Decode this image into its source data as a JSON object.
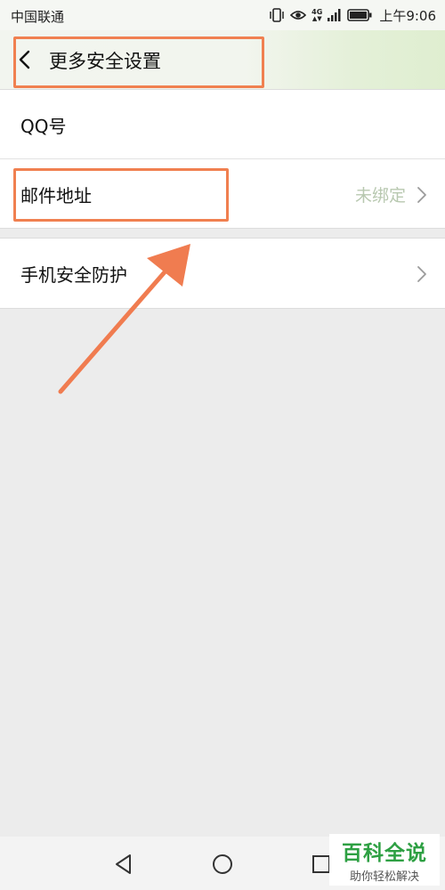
{
  "status_bar": {
    "carrier": "中国联通",
    "network_tag": "4G",
    "time": "上午9:06"
  },
  "header": {
    "title": "更多安全设置"
  },
  "settings": {
    "rows": [
      {
        "label": "QQ号",
        "value": ""
      },
      {
        "label": "邮件地址",
        "value": "未绑定"
      },
      {
        "label": "手机安全防护",
        "value": ""
      }
    ]
  },
  "watermark": {
    "title": "百科全说",
    "subtitle": "助你轻松解决"
  },
  "colors": {
    "annotation": "#f08050",
    "unbound_text": "#b8c8b0",
    "watermark_green": "#2ea043"
  },
  "icons": [
    "back-icon",
    "chevron-right-icon",
    "vibrate-icon",
    "eye-icon",
    "signal-icon",
    "battery-icon",
    "nav-back-icon",
    "nav-home-icon",
    "nav-recents-icon"
  ]
}
